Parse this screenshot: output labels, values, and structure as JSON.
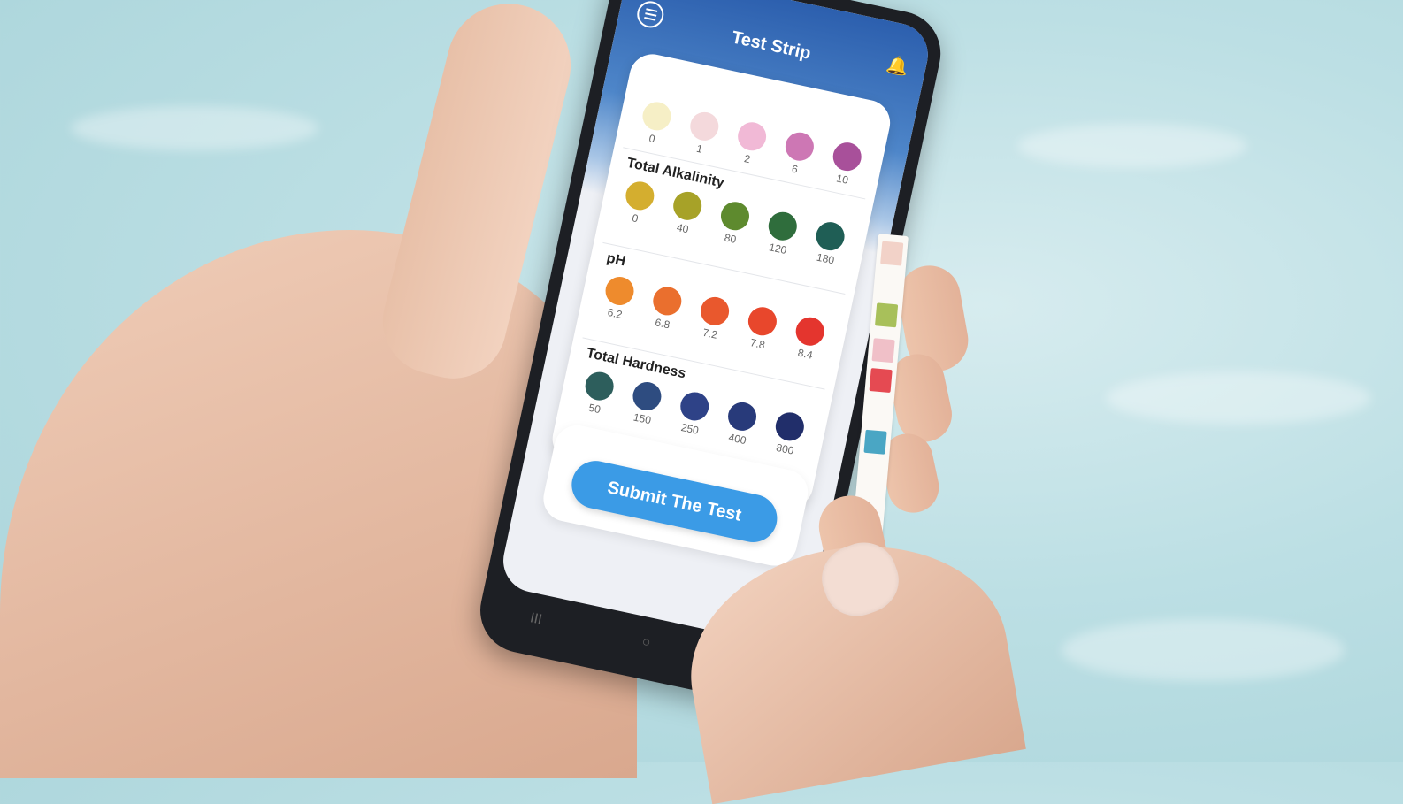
{
  "app": {
    "title": "Test Strip"
  },
  "icons": {
    "menu": "menu-icon",
    "notifications": "bell-icon",
    "nav_recent": "recent-apps-icon",
    "nav_home": "home-icon",
    "nav_back": "back-icon"
  },
  "nav": {
    "recent": "III",
    "home": "○",
    "back": "<"
  },
  "sections": [
    {
      "title": "",
      "swatches": [
        {
          "label": "0",
          "color": "#f6efc6"
        },
        {
          "label": "1",
          "color": "#f4d9dc"
        },
        {
          "label": "2",
          "color": "#f1b9d6"
        },
        {
          "label": "6",
          "color": "#cd77b4"
        },
        {
          "label": "10",
          "color": "#a8509a"
        }
      ]
    },
    {
      "title": "Total Alkalinity",
      "swatches": [
        {
          "label": "0",
          "color": "#d4ae2f"
        },
        {
          "label": "40",
          "color": "#a7a228"
        },
        {
          "label": "80",
          "color": "#5e8a2e"
        },
        {
          "label": "120",
          "color": "#2f6d3c"
        },
        {
          "label": "180",
          "color": "#1f5e55"
        }
      ]
    },
    {
      "title": "pH",
      "swatches": [
        {
          "label": "6.2",
          "color": "#ee8b2d"
        },
        {
          "label": "6.8",
          "color": "#ea6f2e"
        },
        {
          "label": "7.2",
          "color": "#e9582d"
        },
        {
          "label": "7.8",
          "color": "#e8472c"
        },
        {
          "label": "8.4",
          "color": "#e4352e"
        }
      ]
    },
    {
      "title": "Total Hardness",
      "swatches": [
        {
          "label": "50",
          "color": "#2d5e5c"
        },
        {
          "label": "150",
          "color": "#2e4c80"
        },
        {
          "label": "250",
          "color": "#2e4287"
        },
        {
          "label": "400",
          "color": "#283a7a"
        },
        {
          "label": "800",
          "color": "#212e6a"
        }
      ]
    }
  ],
  "submit_label": "Submit The Test",
  "strip_pads": [
    "#f2d2c8",
    "#a8c05a",
    "#f0c0c8",
    "#e54a52",
    "#4aa6c4"
  ]
}
